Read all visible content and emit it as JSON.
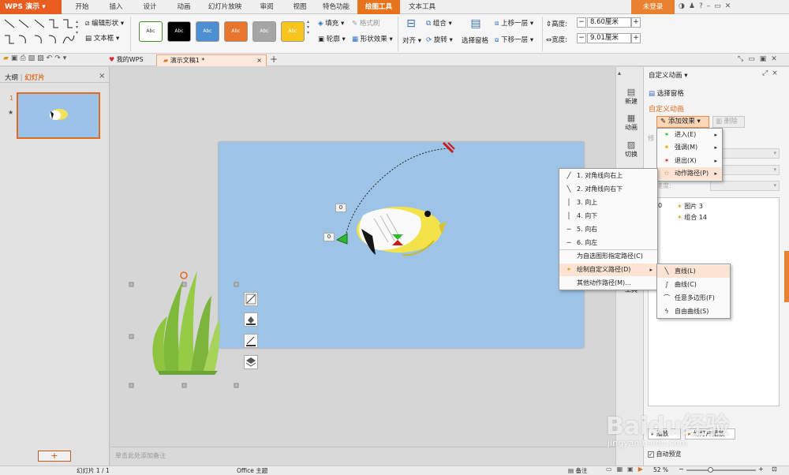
{
  "app": {
    "logo": "WPS 演示"
  },
  "tabs": [
    "开始",
    "插入",
    "设计",
    "动画",
    "幻灯片放映",
    "审阅",
    "视图",
    "特色功能",
    "绘图工具",
    "文本工具"
  ],
  "active_tab": "绘图工具",
  "login": "未登录",
  "ribbon": {
    "edit_shape": "编辑形状",
    "textbox": "文本框",
    "style_labels": [
      "Abc",
      "Abc",
      "Abc",
      "Abc",
      "Abc",
      "Abc"
    ],
    "fill": "填充",
    "format_brush": "格式刷",
    "outline": "轮廓",
    "shape_effect": "形状效果",
    "align": "对齐",
    "group": "组合",
    "rotate": "旋转",
    "selection_pane": "选择窗格",
    "bring_forward": "上移一层",
    "send_backward": "下移一层",
    "height_label": "高度:",
    "height_value": "8.60厘米",
    "width_label": "宽度:",
    "width_value": "9.01厘米",
    "style_colors": [
      "#ffffff",
      "#000000",
      "#4e8fd1",
      "#e8762c",
      "#a5a5a5",
      "#f7c51d"
    ]
  },
  "doc_tabs": {
    "my_wps": "我的WPS",
    "document": "演示文稿1 *"
  },
  "left_panel": {
    "outline_tab": "大纲",
    "slides_tab": "幻灯片",
    "slide_number": "1"
  },
  "slide": {
    "label_zero_a": "0",
    "label_zero_b": "0"
  },
  "notes_placeholder": "单击此处添加备注",
  "status": {
    "slide_info": "幻灯片 1 / 1",
    "theme": "Office 主题",
    "notes": "备注",
    "zoom": "52 %"
  },
  "vertical_tabs": [
    "新建",
    "动画",
    "切换",
    "工具"
  ],
  "right_panel": {
    "header": "自定义动画",
    "selection_pane": "选择窗格",
    "section_title": "自定义动画",
    "add_effect": "添加效果",
    "delete": "删除",
    "modify_prefix": "修",
    "speed_label": "速度:",
    "list_index": "0",
    "list_items": [
      "图片 3",
      "组合 14"
    ],
    "play": "播放",
    "slideshow": "幻灯片播放",
    "auto_preview": "自动预览"
  },
  "effect_menu": [
    {
      "label": "进入(E)",
      "icon": "green-star"
    },
    {
      "label": "强调(M)",
      "icon": "yellow-star"
    },
    {
      "label": "退出(X)",
      "icon": "red-star"
    },
    {
      "label": "动作路径(P)",
      "icon": "path-star"
    }
  ],
  "path_menu": [
    {
      "num": "1.",
      "label": "对角线向右上",
      "icon": "diagonal-up"
    },
    {
      "num": "2.",
      "label": "对角线向右下",
      "icon": "diagonal-down"
    },
    {
      "num": "3.",
      "label": "向上",
      "icon": "line-vertical"
    },
    {
      "num": "4.",
      "label": "向下",
      "icon": "line-vertical"
    },
    {
      "num": "5.",
      "label": "向右",
      "icon": "line-horizontal"
    },
    {
      "num": "6.",
      "label": "向左",
      "icon": "line-horizontal"
    },
    {
      "num": "",
      "label": "为自选图形指定路径(C)",
      "icon": ""
    },
    {
      "num": "",
      "label": "绘制自定义路径(D)",
      "icon": "path-star"
    },
    {
      "num": "",
      "label": "其他动作路径(M)...",
      "icon": ""
    }
  ],
  "custom_menu": [
    {
      "label": "直线(L)",
      "icon": "straight-line"
    },
    {
      "label": "曲线(C)",
      "icon": "curve"
    },
    {
      "label": "任意多边形(F)",
      "icon": "polygon"
    },
    {
      "label": "自由曲线(S)",
      "icon": "freeform"
    }
  ],
  "watermark": {
    "main": "Baidu经验",
    "sub": "jingyan.baidu.com"
  }
}
